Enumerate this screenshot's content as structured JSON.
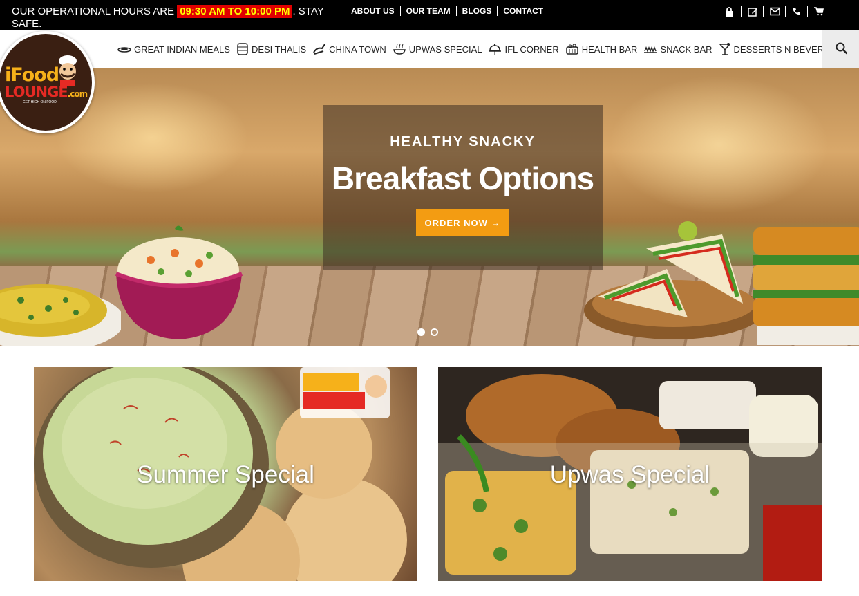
{
  "topbar": {
    "ops_prefix": "OUR OPERATIONAL HOURS ARE",
    "ops_hours": "09:30 AM TO 10:00 PM",
    "ops_suffix": ". STAY SAFE.",
    "links": [
      "ABOUT US",
      "OUR TEAM",
      "BLOGS",
      "CONTACT"
    ],
    "icons": [
      "lock-icon",
      "edit-icon",
      "mail-icon",
      "phone-icon",
      "cart-icon"
    ]
  },
  "logo": {
    "line1": "iFood",
    "line2": "LOUNGE",
    "domain": ".com",
    "tagline": "GET HIGH ON FOOD"
  },
  "nav": {
    "items": [
      {
        "label": "GREAT INDIAN MEALS",
        "icon": "plate-icon"
      },
      {
        "label": "DESI THALIS",
        "icon": "thali-icon"
      },
      {
        "label": "CHINA TOWN",
        "icon": "chopsticks-icon"
      },
      {
        "label": "UPWAS SPECIAL",
        "icon": "dish-icon"
      },
      {
        "label": "IFL CORNER",
        "icon": "cloche-icon"
      },
      {
        "label": "HEALTH BAR",
        "icon": "basket-icon"
      },
      {
        "label": "SNACK BAR",
        "icon": "snack-icon"
      },
      {
        "label": "DESSERTS N BEVERAG",
        "icon": "cocktail-icon"
      }
    ],
    "search_icon": "search-icon"
  },
  "hero": {
    "subtitle": "HEALTHY SNACKY",
    "title": "Breakfast Options",
    "cta": "ORDER NOW →",
    "slides": 2,
    "active_slide": 1
  },
  "cards": [
    {
      "label": "Summer Special"
    },
    {
      "label": "Upwas Special"
    }
  ],
  "colors": {
    "topbar_bg": "#000000",
    "hours_bg": "#e00000",
    "hours_text": "#ffff00",
    "cta_bg": "#f39c12",
    "logo_bg": "#3a1f12"
  }
}
